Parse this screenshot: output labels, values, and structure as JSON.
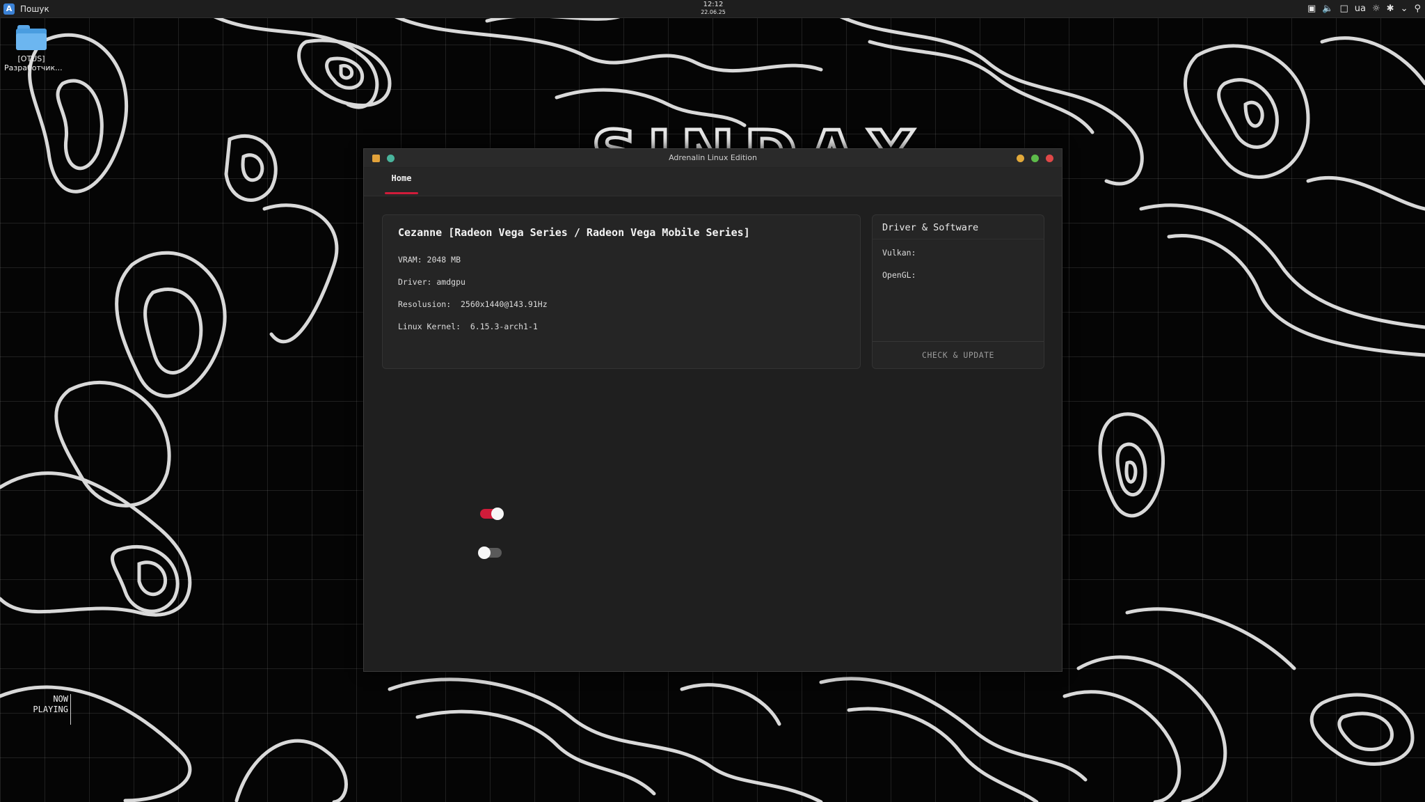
{
  "topbar": {
    "search_label": "Пошук",
    "clock_time": "12:12",
    "clock_date": "22.06.25",
    "tray_items": [
      "discord-icon",
      "volume-icon",
      "notification-icon",
      "ua",
      "brightness-icon",
      "bluetooth-icon",
      "chevron-down-icon",
      "search-icon"
    ],
    "keyboard_layout": "ua"
  },
  "desktop": {
    "folder_label": "[OTUS] Разработчик..."
  },
  "now_playing": {
    "line1": "NOW",
    "line2": "PLAYING"
  },
  "window": {
    "title": "Adrenalin Linux Edition",
    "tabs": [
      {
        "label": "Home",
        "active": true
      }
    ],
    "gpu": {
      "name": "Cezanne [Radeon Vega Series / Radeon Vega Mobile Series]",
      "vram": "VRAM: 2048 MB",
      "driver": "Driver: amdgpu",
      "resolution": "Resolusion:  2560x1440@143.91Hz",
      "kernel": "Linux Kernel:  6.15.3-arch1-1"
    },
    "driver_software": {
      "title": "Driver & Software",
      "vulkan_label": "Vulkan:",
      "opengl_label": "OpenGL:",
      "check_button": "CHECK & UPDATE"
    },
    "toggles": [
      {
        "state": "on",
        "color": "#d01c3a"
      },
      {
        "state": "off",
        "color": "#5a5a5a"
      }
    ]
  },
  "colors": {
    "accent": "#d01c3a",
    "window_bg": "#1f1f1f",
    "card_bg": "#252525"
  }
}
